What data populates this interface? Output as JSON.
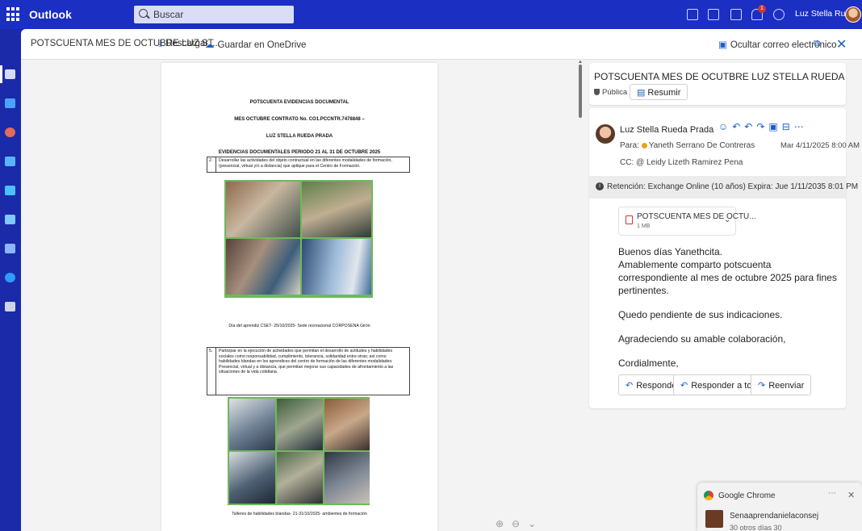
{
  "app": {
    "name": "Outlook",
    "search_placeholder": "Buscar",
    "user": "Luz Stella Rueda P...",
    "notification_count": "1"
  },
  "command_bar": {
    "attachment_title": "POTSCUENTA MES DE OCTUBRE LUZ ST...",
    "download_label": "Descargar",
    "save_onedrive_label": "Guardar en OneDrive",
    "hide_email_label": "Ocultar correo electrónico"
  },
  "document": {
    "heading1": "POTSCUENTA EVIDENCIAS DOCUMENTAL",
    "heading2": "MES OCTUBRE CONTRATO No. CO1.PCCNTR.7478848 –",
    "heading3": "LUZ STELLA RUEDA PRADA",
    "heading4": "EVIDENCIAS DOCUMENTALES PERIODO 21 AL 31 DE OCTUBRE 2025",
    "item1_num": "2.",
    "item1_text": "Desarrollar las actividades del objeto contractual en las diferentes modalidades de formación, (presencial, virtual y/o a distancia) que aplique para el Centro de Formación.",
    "caption1": "Día del aprendiz CSET- 25/10/2025- Sede recreacional CORPOSENA Girón",
    "item2_num": "5.",
    "item2_text": "Participar en la ejecución de actividades que permitan el desarrollo de actitudes y habilidades sociales como responsabilidad, cumplimiento, tolerancia, solidaridad entre otras; así como habilidades blandas en los aprendices del centro de formación de las diferentes modalidades: Presencial, virtual y a distancia, que permitan mejorar sus capacidades de afrontamiento a las situaciones de la vida cotidiana.",
    "caption2": "Talleres de habilidades blandas- 21-31/10/2025- ambientes de formación"
  },
  "email": {
    "subject": "POTSCUENTA MES DE OCUTBRE LUZ STELLA RUEDA",
    "sensitivity": "Pública",
    "summarize_label": "Resumir",
    "sender": "Luz Stella Rueda Prada",
    "to_label": "Para:",
    "to": "Yaneth Serrano De Contreras",
    "date": "Mar 4/11/2025 8:00 AM",
    "cc_label": "CC:",
    "cc": "Leidy Lizeth Ramirez Pena",
    "retention": "Retención: Exchange Online (10 años) Expira: Jue 1/11/2035 8:01 PM",
    "attachment_name": "POTSCUENTA MES DE OCTU...",
    "attachment_size": "1 MB",
    "body": [
      "Buenos días Yanethcita.",
      "Amablemente comparto potscuenta correspondiente al mes de octubre 2025 para fines pertinentes.",
      "",
      "Quedo pendiente de sus indicaciones.",
      "",
      "Agradeciendo su amable colaboración,",
      "",
      "Cordialmente,"
    ],
    "reply_label": "Responder",
    "reply_all_label": "Responder a todos",
    "forward_label": "Reenviar"
  },
  "toast": {
    "app": "Google Chrome",
    "message": "Senaaprendanielaconsej",
    "sub": "30 otros días 30"
  },
  "colors": {
    "accent": "#1b2fc2",
    "link": "#1b5ec7",
    "photo_frame": "#6fb85c"
  }
}
